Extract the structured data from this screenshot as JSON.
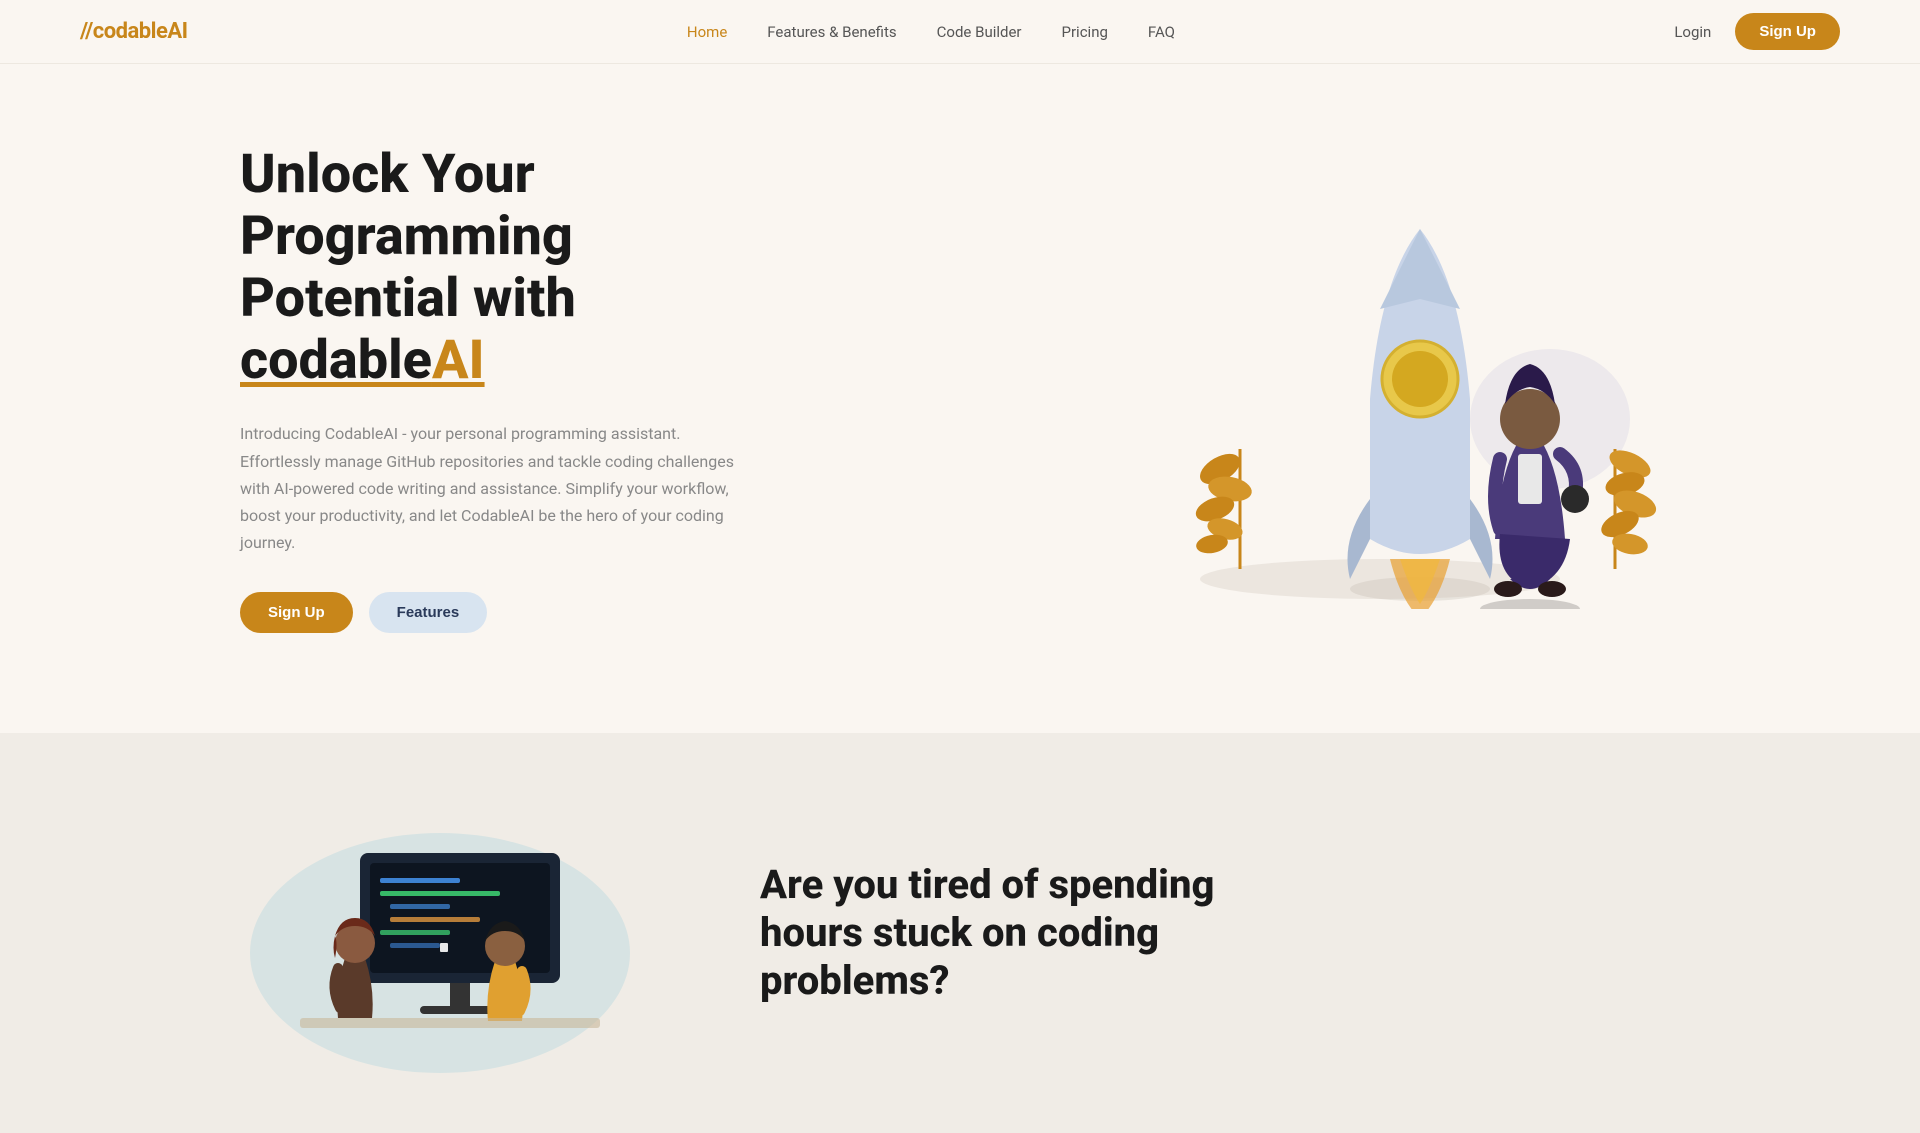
{
  "brand": {
    "slash": "//",
    "codable": "codable",
    "ai": "AI"
  },
  "nav": {
    "links": [
      {
        "label": "Home",
        "active": true,
        "name": "home"
      },
      {
        "label": "Features & Benefits",
        "active": false,
        "name": "features-benefits"
      },
      {
        "label": "Code Builder",
        "active": false,
        "name": "code-builder"
      },
      {
        "label": "Pricing",
        "active": false,
        "name": "pricing"
      },
      {
        "label": "FAQ",
        "active": false,
        "name": "faq"
      }
    ],
    "login_label": "Login",
    "signup_label": "Sign Up"
  },
  "hero": {
    "title_part1": "Unlock Your Programming Potential with ",
    "brand_name": "codable",
    "brand_ai": "AI",
    "description": "Introducing CodableAI - your personal programming assistant. Effortlessly manage GitHub repositories and tackle coding challenges with AI-powered code writing and assistance. Simplify your workflow, boost your productivity, and let CodableAI be the hero of your coding journey.",
    "signup_label": "Sign Up",
    "features_label": "Features"
  },
  "section2": {
    "title": "Are you tired of spending hours stuck on coding problems?"
  },
  "colors": {
    "accent": "#c8861a",
    "background": "#faf6f1",
    "section2_bg": "#f0ece6",
    "text_dark": "#1a1a1a",
    "text_muted": "#888888",
    "btn_features_bg": "#d8e4f0",
    "btn_features_color": "#2a3a5a"
  }
}
